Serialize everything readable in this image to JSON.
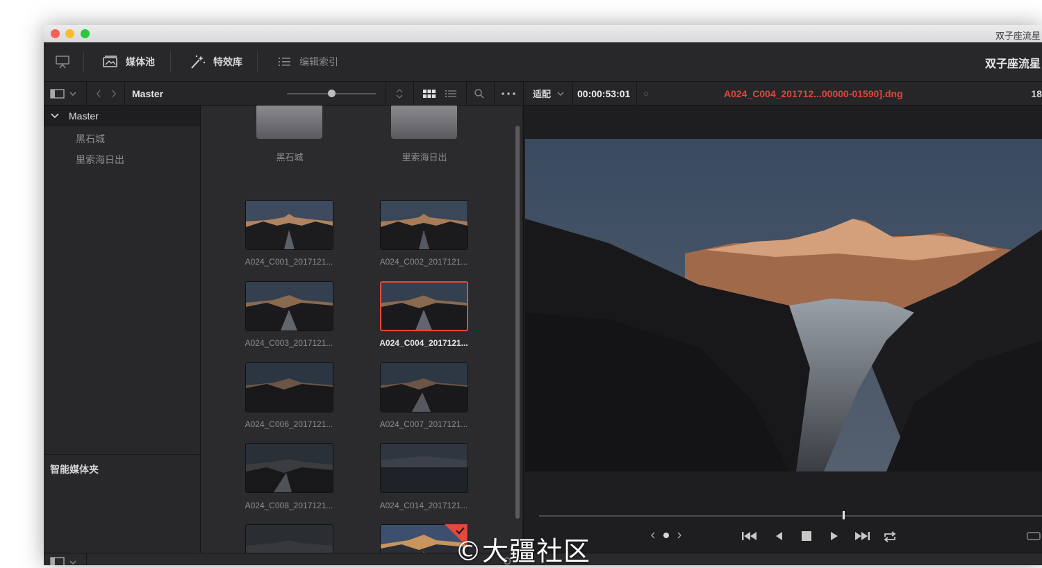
{
  "window": {
    "title": "双子座流星"
  },
  "toolbar": {
    "media_pool_label": "媒体池",
    "effects_label": "特效库",
    "edit_index_label": "编辑索引",
    "project_name": "双子座流星"
  },
  "subbar": {
    "bin_path": "Master",
    "fit_label": "适配",
    "timecode": "00:00:53:01",
    "current_clip": "A024_C004_201712...00000-01590].dng",
    "right_value": "18"
  },
  "bins": {
    "root": "Master",
    "children": [
      "黑石城",
      "里索海日出"
    ],
    "smart_bins_label": "智能媒体夹"
  },
  "pool": {
    "folders": [
      "黑石城",
      "里索海日出"
    ],
    "clips": [
      {
        "name": "A024_C001_2017121..."
      },
      {
        "name": "A024_C002_2017121..."
      },
      {
        "name": "A024_C003_2017121..."
      },
      {
        "name": "A024_C004_2017121...",
        "selected": true
      },
      {
        "name": "A024_C006_2017121..."
      },
      {
        "name": "A024_C007_2017121..."
      },
      {
        "name": "A024_C008_2017121..."
      },
      {
        "name": "A024_C014_2017121..."
      }
    ]
  },
  "viewer": {
    "playhead_fraction": 0.6
  },
  "colors": {
    "accent_red": "#e5483c",
    "panel_bg": "#28282b",
    "viewer_bg": "#1e1e20"
  },
  "watermark": "©大疆社区"
}
